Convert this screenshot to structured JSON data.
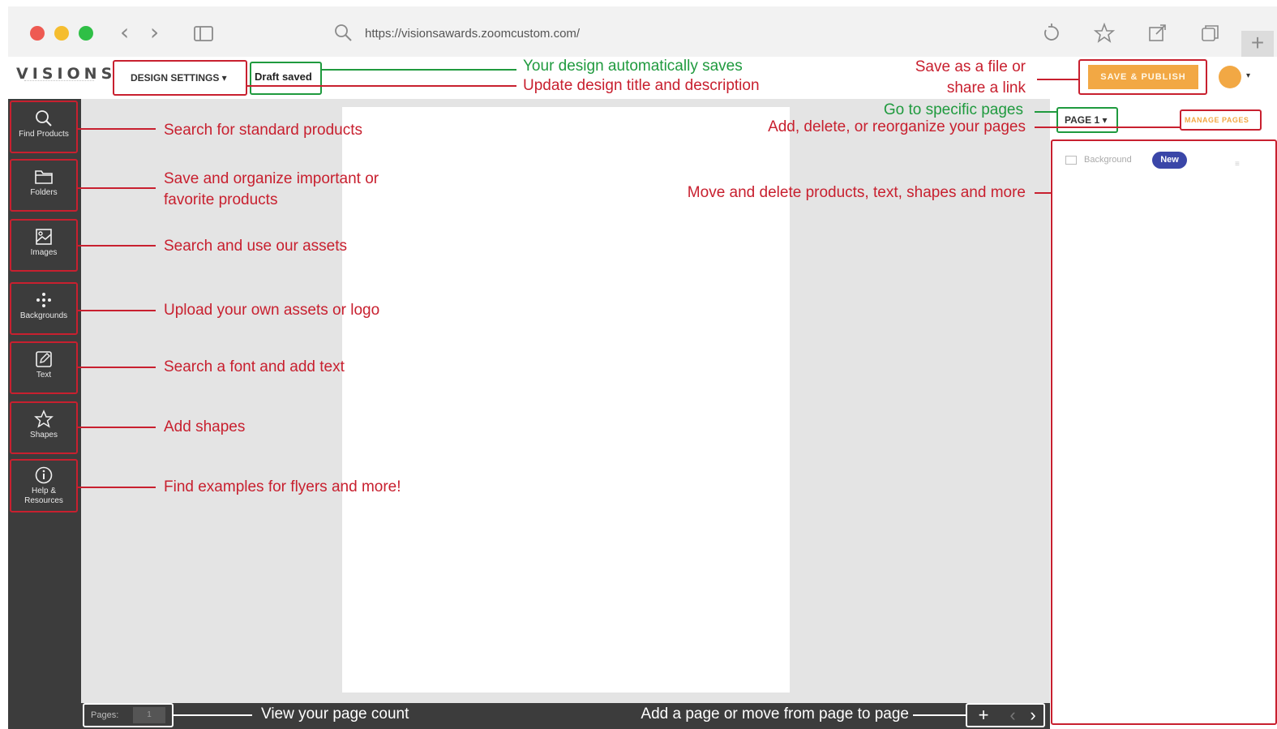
{
  "browser": {
    "url": "https://visionsawards.zoomcustom.com/",
    "new_tab_label": "+"
  },
  "header": {
    "logo_text": "VISIONS",
    "design_settings_label": "DESIGN SETTINGS ▾",
    "draft_status": "Draft saved",
    "save_publish_label": "SAVE & PUBLISH",
    "avatar_caret": "▾"
  },
  "sidebar": {
    "items": [
      {
        "label": "Find Products",
        "icon": "search-icon"
      },
      {
        "label": "Folders",
        "icon": "folder-icon"
      },
      {
        "label": "Images",
        "icon": "image-icon"
      },
      {
        "label": "Backgrounds",
        "icon": "dots-icon"
      },
      {
        "label": "Text",
        "icon": "pencil-icon"
      },
      {
        "label": "Shapes",
        "icon": "star-icon"
      },
      {
        "label": "Help & Resources",
        "icon": "info-icon"
      }
    ]
  },
  "bottom_bar": {
    "pages_label": "Pages:",
    "pages_value": "1",
    "add_label": "+",
    "prev_label": "‹",
    "next_label": "›"
  },
  "right_panel": {
    "page_select": "PAGE 1 ▾",
    "manage_pages": "MANAGE PAGES",
    "layers": [
      {
        "name": "Background",
        "badge": "New"
      }
    ]
  },
  "annotations": {
    "autosave": "Your design automatically saves",
    "title_desc": "Update design title and description",
    "save_file_line1": "Save as a file or",
    "save_file_line2": "share a link",
    "specific_pages": "Go to specific pages",
    "reorganize": "Add, delete, or reorganize your pages",
    "move_delete": "Move and delete products, text, shapes and more",
    "find_products": "Search for standard products",
    "folders_line1": "Save and organize important or",
    "folders_line2": "favorite products",
    "images": "Search and use our assets",
    "backgrounds": "Upload your own assets or logo",
    "text": "Search a font and add text",
    "shapes": "Add shapes",
    "help": "Find examples for flyers and more!",
    "page_count": "View your page count",
    "page_nav": "Add a page or move from page to page"
  },
  "colors": {
    "annotation_red": "#c8202f",
    "annotation_green": "#1f9a3e",
    "accent_orange": "#f2a844",
    "badge_blue": "#3a46a8",
    "sidebar_dark": "#3c3c3c"
  }
}
